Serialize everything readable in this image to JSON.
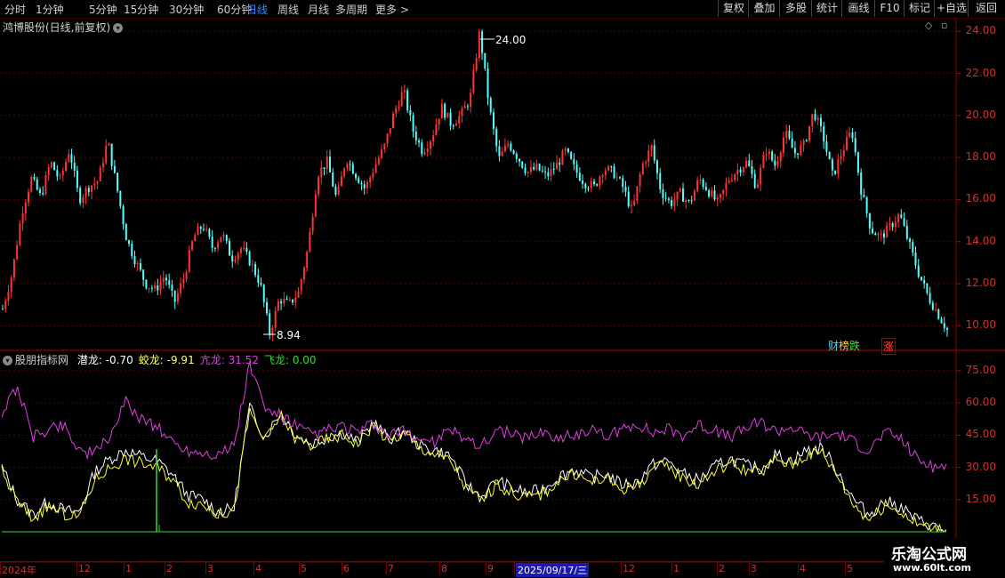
{
  "toolbar": {
    "timeframes": [
      "分时",
      "1分钟",
      "5分钟",
      "15分钟",
      "30分钟",
      "60分钟",
      "日线",
      "周线",
      "月线",
      "多周期",
      "更多 >"
    ],
    "active": "日线",
    "right_buttons": [
      "复权",
      "叠加",
      "多股",
      "统计",
      "画线",
      "F10",
      "标记",
      "+自选",
      "返回"
    ]
  },
  "main_panel": {
    "title": "鸿博股份(日线,前复权)",
    "high_label": "24.00",
    "low_label": "8.94",
    "axis_ticks": [
      "24.00",
      "22.00",
      "20.00",
      "18.00",
      "16.00",
      "14.00",
      "12.00",
      "10.00"
    ],
    "badges": {
      "cai": "财",
      "bang": "榜",
      "die": "跌",
      "zhang": "涨"
    }
  },
  "indicator_panel": {
    "name": "股朋指标网",
    "series": [
      {
        "name": "潜龙",
        "value": "-0.70",
        "color": "#ffffff"
      },
      {
        "name": "蛟龙",
        "value": "-9.91",
        "color": "#ffff33"
      },
      {
        "name": "亢龙",
        "value": "31.52",
        "color": "#e040e0"
      },
      {
        "name": "飞龙",
        "value": "0.00",
        "color": "#33dd33"
      }
    ],
    "axis_ticks": [
      "75.00",
      "60.00",
      "45.00",
      "30.00",
      "15.00"
    ]
  },
  "date_axis": {
    "labels": [
      "2024年",
      "12",
      "1",
      "2",
      "3",
      "4",
      "5",
      "6",
      "7",
      "8",
      "9",
      "2025/09/17/三",
      "12",
      "1",
      "2",
      "3",
      "4",
      "5"
    ]
  },
  "watermark": {
    "line1": "乐淘公式网",
    "line2": "www.60lt.com"
  },
  "chart_data": {
    "type": "candlestick",
    "title": "鸿博股份(日线,前复权)",
    "ylim": [
      9.0,
      24.6
    ],
    "annotations": [
      {
        "label": "24.00",
        "value": 24.0
      },
      {
        "label": "8.94",
        "value": 8.94
      }
    ],
    "close_path": [
      10.8,
      12.5,
      15.4,
      17.0,
      16.1,
      17.8,
      16.9,
      18.4,
      16.0,
      16.6,
      16.9,
      18.8,
      16.5,
      14.1,
      13.0,
      12.0,
      11.7,
      12.4,
      11.1,
      12.3,
      14.2,
      14.8,
      13.7,
      14.4,
      13.2,
      13.7,
      13.0,
      12.0,
      9.6,
      11.3,
      11.0,
      11.6,
      13.7,
      17.2,
      17.8,
      16.0,
      18.0,
      17.2,
      16.5,
      17.6,
      18.5,
      20.1,
      21.2,
      19.3,
      18.3,
      19.0,
      20.4,
      19.6,
      20.0,
      20.8,
      24.0,
      20.4,
      17.9,
      18.7,
      18.0,
      17.3,
      17.5,
      17.1,
      17.6,
      18.3,
      17.4,
      16.8,
      16.6,
      17.5,
      17.3,
      16.6,
      15.4,
      17.6,
      18.5,
      16.4,
      15.8,
      16.3,
      15.8,
      17.0,
      16.4,
      15.8,
      16.9,
      17.4,
      17.8,
      16.6,
      18.4,
      17.6,
      19.2,
      18.2,
      18.6,
      20.2,
      19.0,
      17.1,
      18.3,
      19.3,
      16.4,
      14.6,
      14.2,
      14.7,
      15.3,
      13.9,
      12.5,
      11.4,
      10.6,
      9.8
    ],
    "indicator": {
      "type": "line",
      "ylim": [
        0,
        82
      ],
      "series": [
        {
          "name": "潜龙",
          "values": [
            30,
            15,
            8,
            14,
            10,
            9,
            28,
            34,
            38,
            35,
            33,
            27,
            17,
            15,
            9,
            11,
            58,
            44,
            56,
            45,
            41,
            44,
            46,
            42,
            51,
            43,
            47,
            40,
            38,
            35,
            22,
            16,
            24,
            20,
            18,
            20,
            26,
            29,
            25,
            27,
            22,
            23,
            31,
            33,
            27,
            24,
            30,
            34,
            31,
            29,
            36,
            33,
            38,
            39,
            28,
            15,
            8,
            14,
            12,
            6,
            3,
            0
          ]
        },
        {
          "name": "蛟龙",
          "values": [
            28,
            14,
            6,
            12,
            8,
            7,
            24,
            30,
            34,
            32,
            30,
            25,
            14,
            13,
            8,
            10,
            56,
            42,
            54,
            43,
            40,
            43,
            45,
            41,
            50,
            42,
            46,
            39,
            36,
            33,
            20,
            15,
            22,
            18,
            16,
            18,
            24,
            27,
            23,
            25,
            20,
            21,
            29,
            31,
            25,
            22,
            28,
            32,
            29,
            27,
            34,
            31,
            36,
            37,
            26,
            13,
            6,
            12,
            10,
            4,
            2,
            0
          ]
        },
        {
          "name": "亢龙",
          "values": [
            55,
            68,
            44,
            48,
            50,
            38,
            36,
            45,
            60,
            53,
            49,
            42,
            38,
            37,
            36,
            40,
            78,
            57,
            54,
            49,
            45,
            47,
            49,
            46,
            50,
            44,
            47,
            43,
            42,
            47,
            44,
            40,
            48,
            45,
            44,
            47,
            43,
            45,
            48,
            44,
            47,
            51,
            46,
            48,
            45,
            50,
            47,
            44,
            48,
            51,
            47,
            49,
            45,
            44,
            46,
            42,
            38,
            46,
            44,
            35,
            30,
            31
          ]
        },
        {
          "name": "飞龙",
          "values": [
            0,
            0,
            0,
            0,
            0,
            0,
            0,
            0,
            0,
            0,
            0,
            0,
            0,
            0,
            0,
            0,
            0,
            0,
            0,
            0,
            0,
            0,
            0,
            0,
            0,
            0,
            0,
            0,
            0,
            0,
            0,
            0,
            0,
            0,
            0,
            0,
            0,
            0,
            0,
            0,
            0,
            0,
            0,
            0,
            0,
            0,
            0,
            0,
            0,
            0,
            0,
            0,
            0,
            0,
            0,
            0,
            0,
            0,
            0,
            0,
            0,
            0
          ]
        }
      ]
    }
  }
}
